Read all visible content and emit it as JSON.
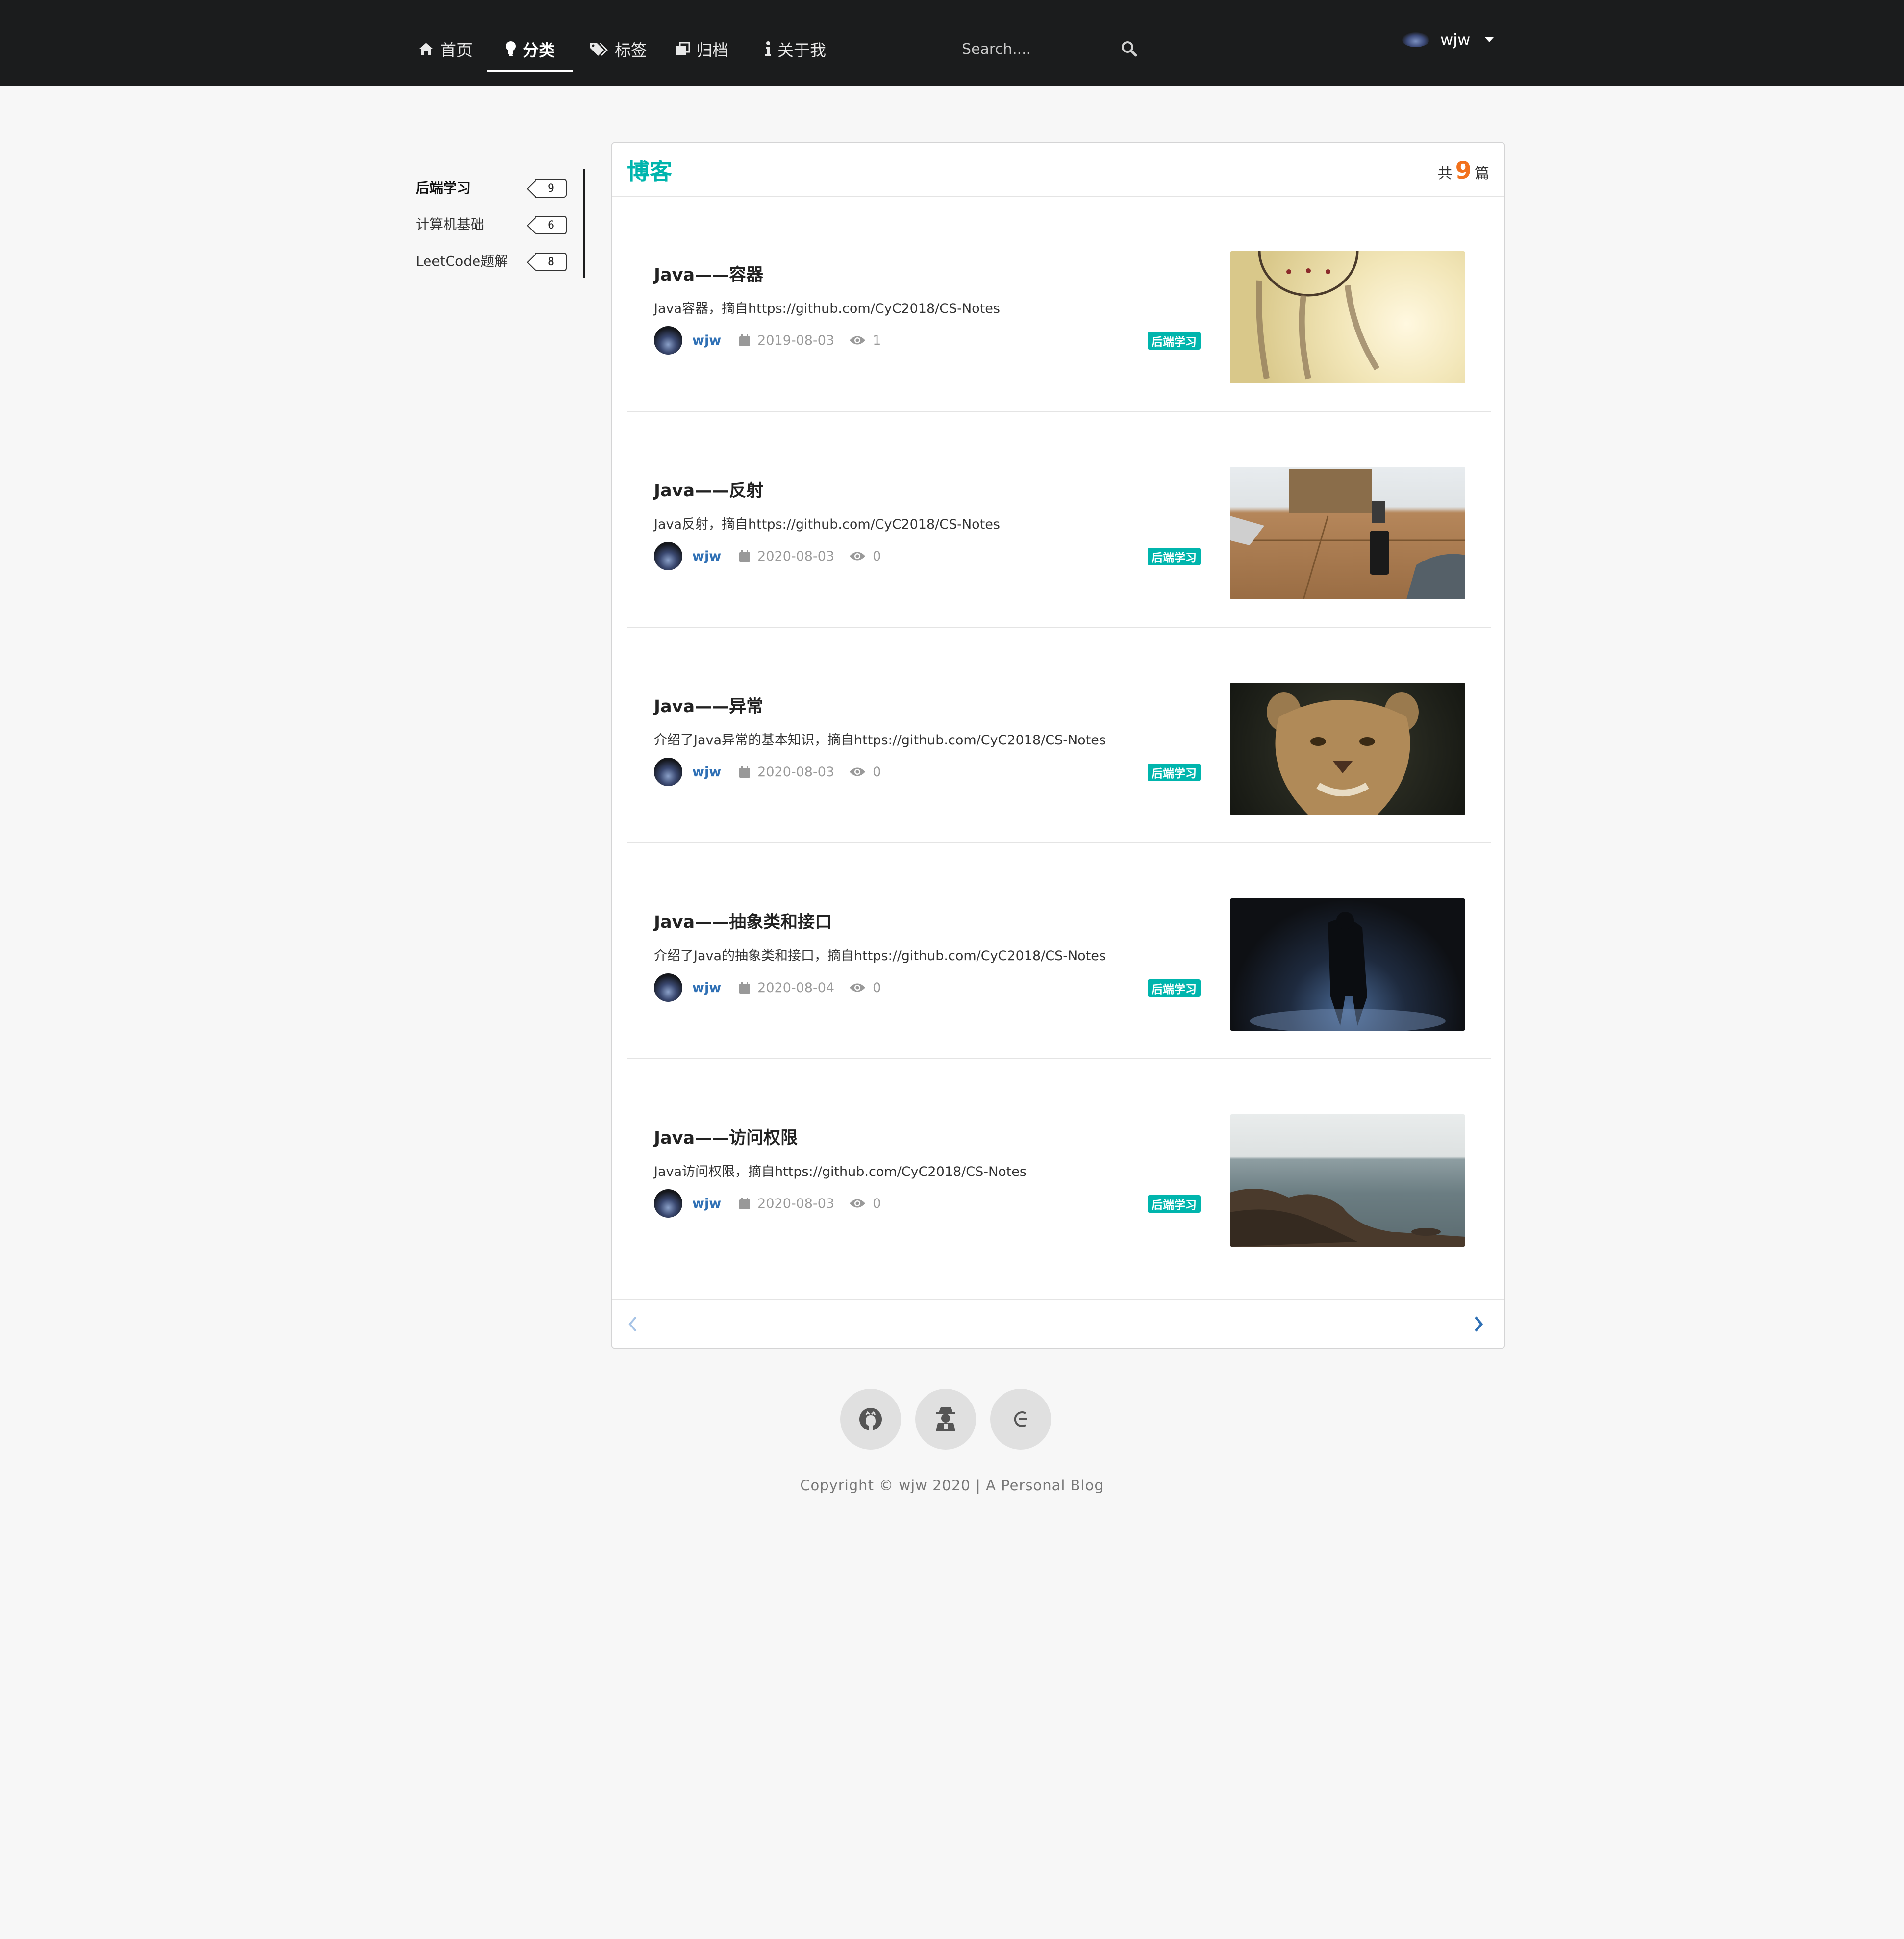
{
  "navbar": {
    "items": [
      {
        "label": "首页",
        "icon": "home-icon"
      },
      {
        "label": "分类",
        "icon": "lightbulb-icon",
        "active": true
      },
      {
        "label": "标签",
        "icon": "tags-icon"
      },
      {
        "label": "归档",
        "icon": "clone-icon"
      },
      {
        "label": "关于我",
        "icon": "info-icon"
      }
    ],
    "search": {
      "placeholder": "Search...."
    },
    "user": {
      "name": "wjw"
    }
  },
  "categories": [
    {
      "label": "后端学习",
      "count": "9",
      "active": true
    },
    {
      "label": "计算机基础",
      "count": "6"
    },
    {
      "label": "LeetCode题解",
      "count": "8"
    }
  ],
  "main": {
    "title": "博客",
    "count_prefix": "共",
    "count": "9",
    "count_suffix": "篇",
    "posts": [
      {
        "title": "Java——容器",
        "desc": "Java容器，摘自https://github.com/CyC2018/CS-Notes",
        "author": "wjw",
        "date": "2019-08-03",
        "views": "1",
        "tag": "后端学习",
        "image": "dreamcatcher"
      },
      {
        "title": "Java——反射",
        "desc": "Java反射，摘自https://github.com/CyC2018/CS-Notes",
        "author": "wjw",
        "date": "2020-08-03",
        "views": "0",
        "tag": "后端学习",
        "image": "wooden-table-phone"
      },
      {
        "title": "Java——异常",
        "desc": "介绍了Java异常的基本知识，摘自https://github.com/CyC2018/CS-Notes",
        "author": "wjw",
        "date": "2020-08-03",
        "views": "0",
        "tag": "后端学习",
        "image": "lioness"
      },
      {
        "title": "Java——抽象类和接口",
        "desc": "介绍了Java的抽象类和接口，摘自https://github.com/CyC2018/CS-Notes",
        "author": "wjw",
        "date": "2020-08-04",
        "views": "0",
        "tag": "后端学习",
        "image": "person-in-dark-rain"
      },
      {
        "title": "Java——访问权限",
        "desc": "Java访问权限，摘自https://github.com/CyC2018/CS-Notes",
        "author": "wjw",
        "date": "2020-08-03",
        "views": "0",
        "tag": "后端学习",
        "image": "rocky-seashore"
      }
    ]
  },
  "footer": {
    "social": [
      "github-icon",
      "user-secret-icon",
      "csdn-icon"
    ],
    "copyright": "Copyright © wjw 2020 | A Personal Blog"
  },
  "colors": {
    "accent": "#00b5ad",
    "count": "#f2711c",
    "link": "#2f70b5",
    "navbar": "#1b1c1d"
  }
}
